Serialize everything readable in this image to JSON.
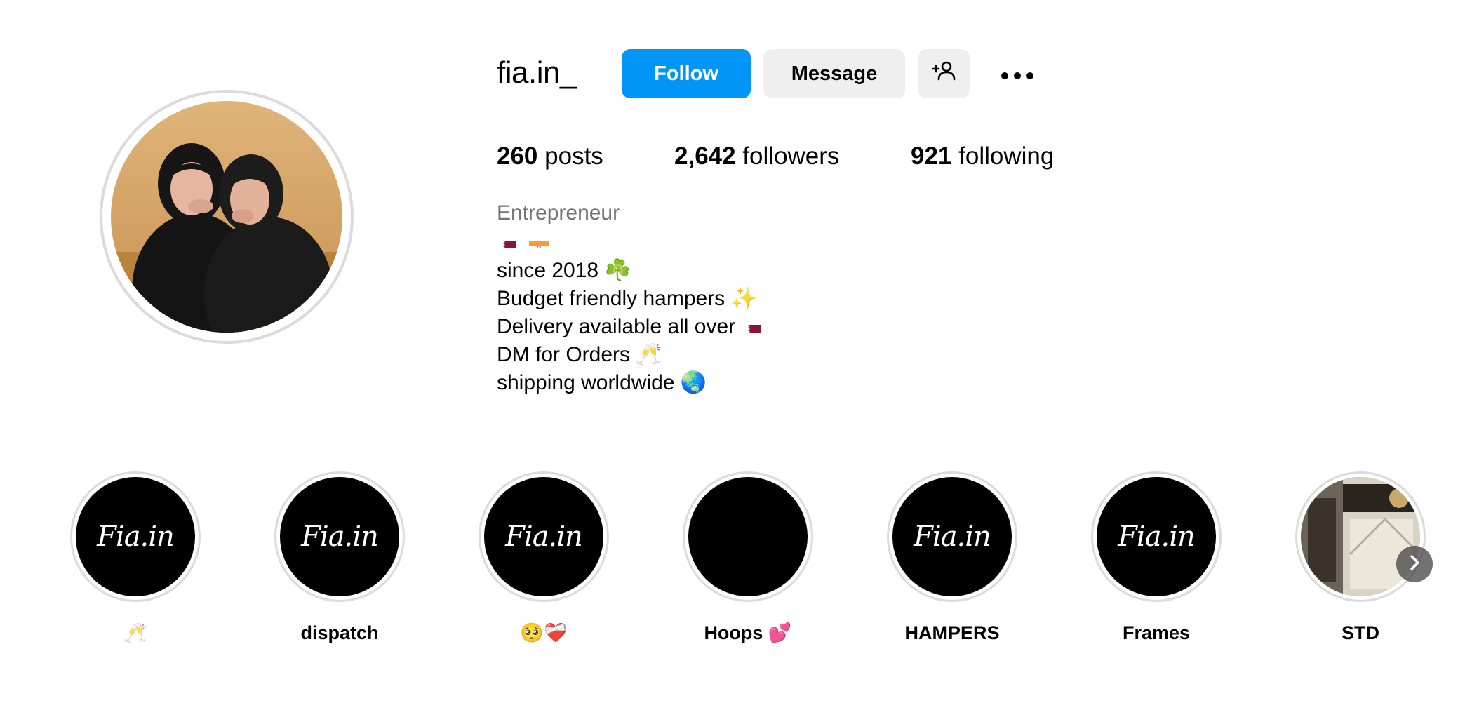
{
  "profile": {
    "username": "fia.in_",
    "avatar_alt": "profile photo"
  },
  "actions": {
    "follow_label": "Follow",
    "message_label": "Message",
    "add_user_icon": "add-user-icon",
    "more_icon": "more-options-icon"
  },
  "stats": {
    "posts_count": "260",
    "posts_label": "posts",
    "followers_count": "2,642",
    "followers_label": "followers",
    "following_count": "921",
    "following_label": "following"
  },
  "bio": {
    "category": "Entrepreneur",
    "flags": [
      "qatar-flag",
      "india-flag"
    ],
    "lines": [
      "since 2018 ☘️",
      "Budget friendly hampers ✨",
      "Delivery available all over",
      "DM for Orders 🥂",
      "shipping worldwide 🌏"
    ]
  },
  "highlights": [
    {
      "label": "🥂",
      "cover": "Fia.in"
    },
    {
      "label": "dispatch",
      "cover": "Fia.in"
    },
    {
      "label": "🥺❤️‍🩹",
      "cover": "Fia.in"
    },
    {
      "label": "Hoops 💕",
      "cover": ""
    },
    {
      "label": "HAMPERS",
      "cover": "Fia.in"
    },
    {
      "label": "Frames",
      "cover": "Fia.in"
    },
    {
      "label": "STD",
      "cover": "photo"
    }
  ],
  "colors": {
    "follow_button": "#0095f6",
    "secondary_button": "#efefef",
    "muted_text": "#737373",
    "ring": "#dbdbdb"
  }
}
